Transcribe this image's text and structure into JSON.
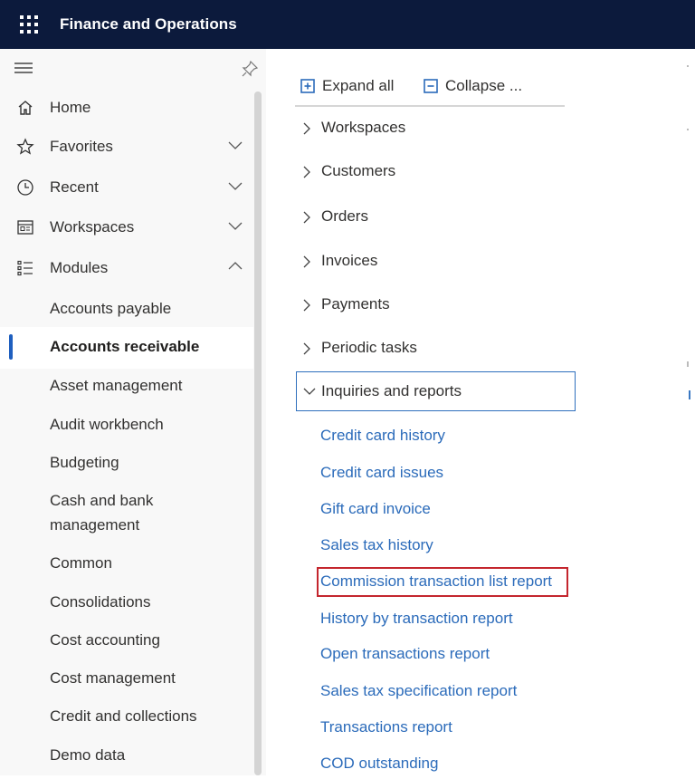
{
  "app": {
    "title": "Finance and Operations"
  },
  "nav": {
    "top_items": [
      {
        "label": "Home",
        "icon": "home-icon"
      },
      {
        "label": "Favorites",
        "icon": "star-icon",
        "expand": "collapsed"
      },
      {
        "label": "Recent",
        "icon": "clock-icon",
        "expand": "collapsed"
      },
      {
        "label": "Workspaces",
        "icon": "workspace-icon",
        "expand": "collapsed"
      },
      {
        "label": "Modules",
        "icon": "list-icon",
        "expand": "expanded"
      }
    ],
    "modules": [
      {
        "label": "Accounts payable"
      },
      {
        "label": "Accounts receivable",
        "selected": true
      },
      {
        "label": "Asset management"
      },
      {
        "label": "Audit workbench"
      },
      {
        "label": "Budgeting"
      },
      {
        "label_line1": "Cash and bank",
        "label_line2": "management"
      },
      {
        "label": "Common"
      },
      {
        "label": "Consolidations"
      },
      {
        "label": "Cost accounting"
      },
      {
        "label": "Cost management"
      },
      {
        "label": "Credit and collections"
      },
      {
        "label": "Demo data"
      }
    ]
  },
  "toolbar": {
    "expand_all": "Expand all",
    "collapse_all": "Collapse ..."
  },
  "sections": [
    {
      "label": "Workspaces"
    },
    {
      "label": "Customers"
    },
    {
      "label": "Orders"
    },
    {
      "label": "Invoices"
    },
    {
      "label": "Payments"
    },
    {
      "label": "Periodic tasks"
    }
  ],
  "open_section": {
    "label": "Inquiries and reports",
    "links": [
      "Credit card history",
      "Credit card issues",
      "Gift card invoice",
      "Sales tax history",
      "Commission transaction list report",
      "History by transaction report",
      "Open transactions report",
      "Sales tax specification report",
      "Transactions report",
      "COD outstanding"
    ]
  },
  "colors": {
    "topbar": "#0c1a3c",
    "link": "#2b6bba",
    "highlight": "#c4262e",
    "selection": "#1f5fbf"
  }
}
